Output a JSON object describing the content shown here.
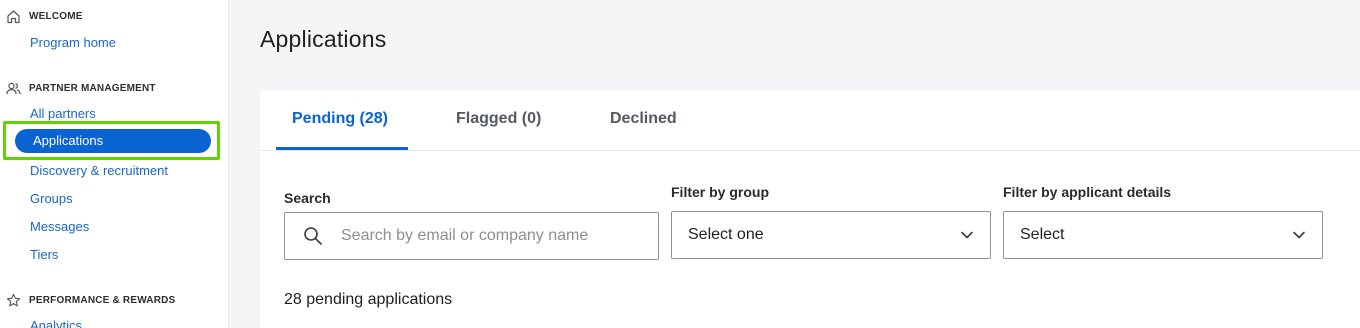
{
  "sidebar": {
    "welcome": {
      "heading": "WELCOME",
      "icon": "home-icon",
      "items": [
        {
          "label": "Program home"
        }
      ]
    },
    "partner_management": {
      "heading": "PARTNER MANAGEMENT",
      "icon": "people-icon",
      "items": [
        {
          "label": "All partners"
        },
        {
          "label": "Applications",
          "active": true
        },
        {
          "label": "Discovery & recruitment"
        },
        {
          "label": "Groups"
        },
        {
          "label": "Messages"
        },
        {
          "label": "Tiers"
        }
      ]
    },
    "performance_rewards": {
      "heading": "PERFORMANCE & REWARDS",
      "icon": "star-icon",
      "items": [
        {
          "label": "Analytics"
        }
      ]
    }
  },
  "main": {
    "title": "Applications",
    "tabs": [
      {
        "label": "Pending (28)",
        "active": true
      },
      {
        "label": "Flagged (0)"
      },
      {
        "label": "Declined"
      }
    ],
    "filters": {
      "search_label": "Search",
      "search_placeholder": "Search by email or company name",
      "search_value": "",
      "group_label": "Filter by group",
      "group_value": "Select one",
      "applicant_label": "Filter by applicant details",
      "applicant_value": "Select"
    },
    "count_text": "28 pending applications"
  },
  "colors": {
    "accent": "#0a63d3",
    "highlight": "#5fd400",
    "link": "#1a66c8"
  }
}
